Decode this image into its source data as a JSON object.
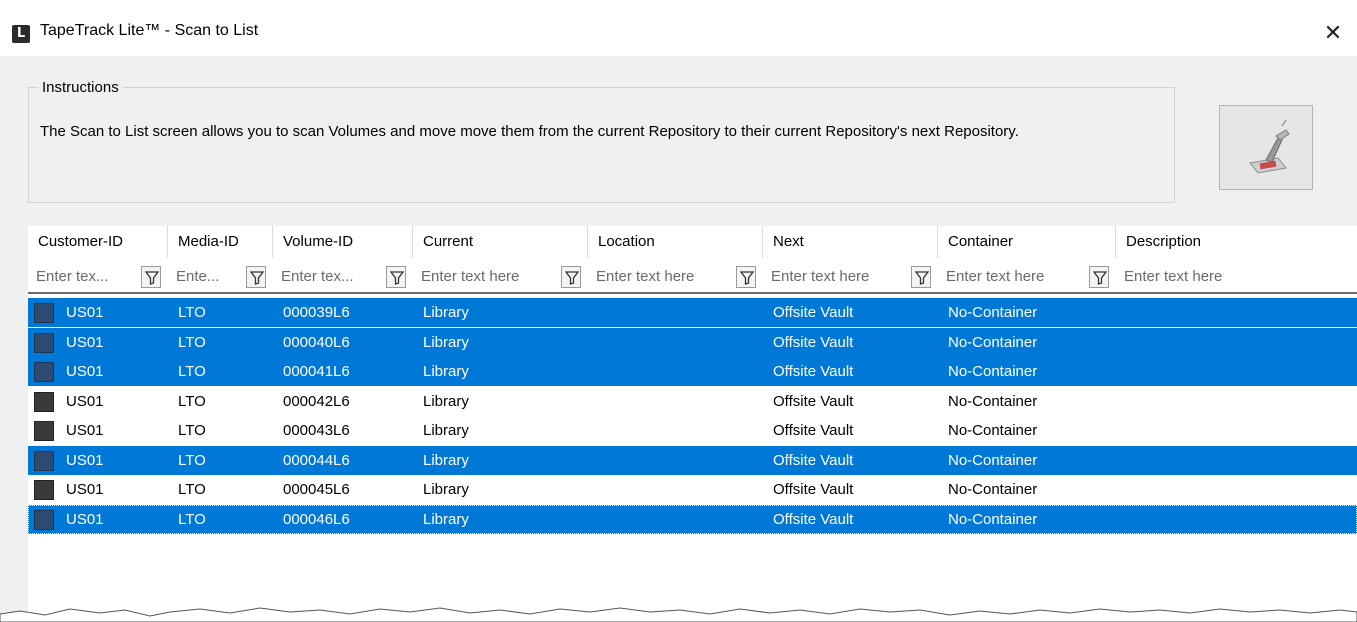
{
  "window": {
    "title": "TapeTrack Lite™ - Scan to List",
    "app_icon": "L",
    "close_glyph": "✕"
  },
  "instructions": {
    "group_label": "Instructions",
    "text": "The Scan to List screen allows you to scan Volumes and move move them from the current Repository to their current Repository's next Repository."
  },
  "grid": {
    "columns": [
      {
        "label": "Customer-ID",
        "placeholder": "Enter tex..."
      },
      {
        "label": "Media-ID",
        "placeholder": "Ente..."
      },
      {
        "label": "Volume-ID",
        "placeholder": "Enter tex..."
      },
      {
        "label": "Current",
        "placeholder": "Enter text here"
      },
      {
        "label": "Location",
        "placeholder": "Enter text here"
      },
      {
        "label": "Next",
        "placeholder": "Enter text here"
      },
      {
        "label": "Container",
        "placeholder": "Enter text here"
      },
      {
        "label": "Description",
        "placeholder": "Enter text here"
      }
    ],
    "rows": [
      {
        "selected": true,
        "cells": [
          "US01",
          "LTO",
          "000039L6",
          "Library",
          "",
          "Offsite Vault",
          "No-Container",
          ""
        ]
      },
      {
        "selected": true,
        "cells": [
          "US01",
          "LTO",
          "000040L6",
          "Library",
          "",
          "Offsite Vault",
          "No-Container",
          ""
        ]
      },
      {
        "selected": true,
        "cells": [
          "US01",
          "LTO",
          "000041L6",
          "Library",
          "",
          "Offsite Vault",
          "No-Container",
          ""
        ]
      },
      {
        "selected": false,
        "cells": [
          "US01",
          "LTO",
          "000042L6",
          "Library",
          "",
          "Offsite Vault",
          "No-Container",
          ""
        ]
      },
      {
        "selected": false,
        "cells": [
          "US01",
          "LTO",
          "000043L6",
          "Library",
          "",
          "Offsite Vault",
          "No-Container",
          ""
        ]
      },
      {
        "selected": true,
        "cells": [
          "US01",
          "LTO",
          "000044L6",
          "Library",
          "",
          "Offsite Vault",
          "No-Container",
          ""
        ]
      },
      {
        "selected": false,
        "cells": [
          "US01",
          "LTO",
          "000045L6",
          "Library",
          "",
          "Offsite Vault",
          "No-Container",
          ""
        ]
      },
      {
        "selected": true,
        "cells": [
          "US01",
          "LTO",
          "000046L6",
          "Library",
          "",
          "Offsite Vault",
          "No-Container",
          ""
        ]
      }
    ]
  },
  "colors": {
    "selection": "#0078d7",
    "window_bg": "#f0f0f0"
  }
}
